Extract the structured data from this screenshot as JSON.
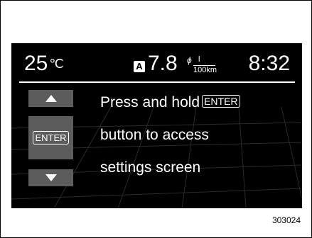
{
  "status": {
    "temperature": "25",
    "temperature_unit": "℃",
    "mode_badge": "A",
    "fuel_economy": "7.8",
    "economy_unit_phi": "ϕ",
    "economy_unit_numerator": "l",
    "economy_unit_denominator": "100km",
    "clock": "8:32"
  },
  "buttons": {
    "up_icon": "triangle-up",
    "enter_label": "ENTER",
    "down_icon": "triangle-down"
  },
  "message": {
    "line1_text": "Press and hold",
    "line1_key": "ENTER",
    "line2": "button to access",
    "line3": "settings screen"
  },
  "figure_code": "303024"
}
